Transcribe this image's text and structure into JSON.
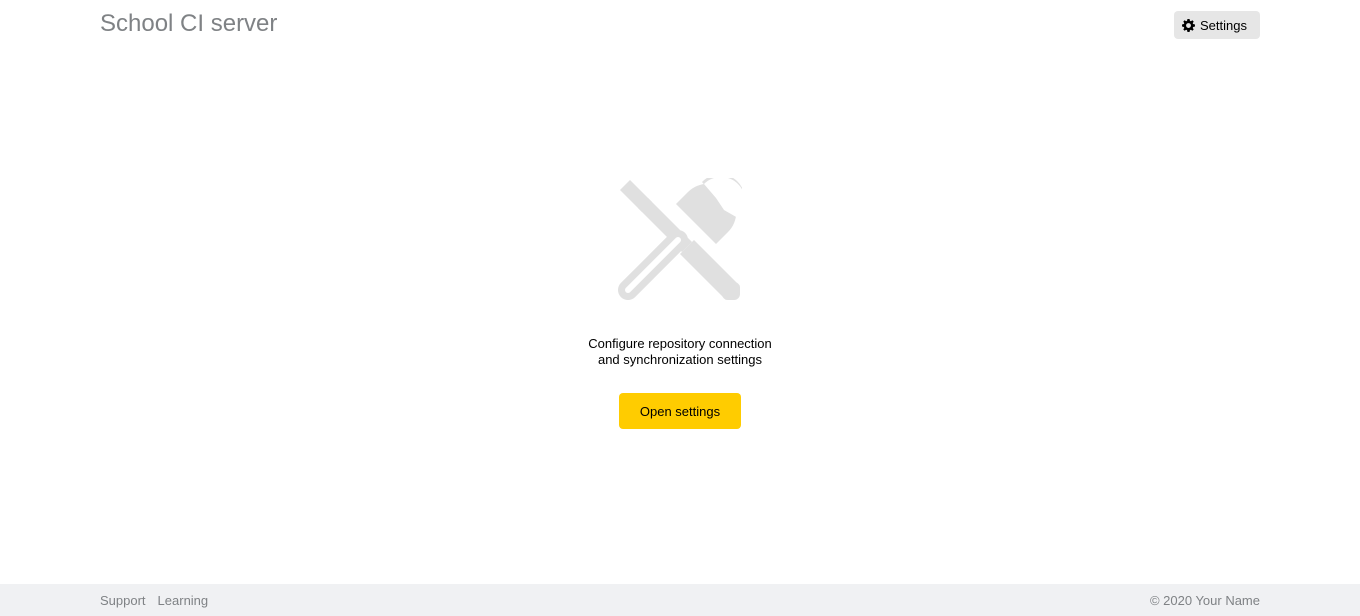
{
  "header": {
    "title": "School CI server",
    "settings_label": "Settings",
    "settings_icon": "gear-icon"
  },
  "empty_state": {
    "icon": "tools-icon",
    "message_line1": "Configure repository connection",
    "message_line2": "and synchronization settings",
    "button_label": "Open settings"
  },
  "footer": {
    "links": [
      {
        "label": "Support"
      },
      {
        "label": "Learning"
      }
    ],
    "copyright": "© 2020 Your Name"
  },
  "colors": {
    "accent": "#ffcc00",
    "muted_text": "#7f8285",
    "icon_gray": "#e0e0e0",
    "footer_bg": "#f0f1f3",
    "settings_button_bg": "#e6e6e6"
  }
}
